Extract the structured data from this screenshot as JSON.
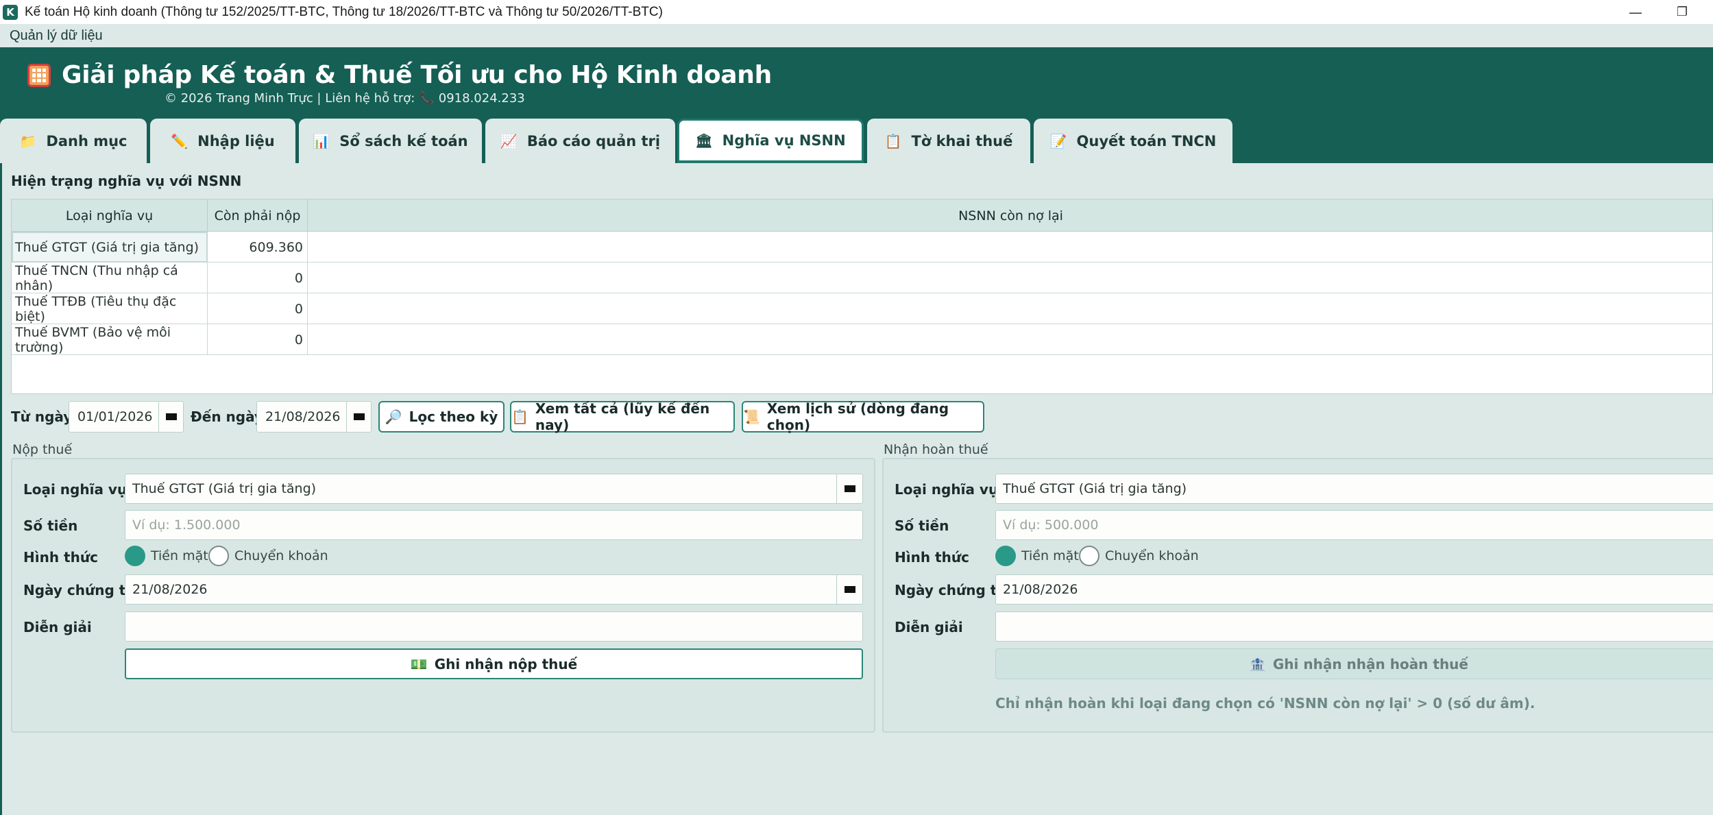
{
  "window": {
    "icon_letter": "K",
    "title": "Kế toán Hộ kinh doanh (Thông tư 152/2025/TT-BTC, Thông tư 18/2026/TT-BTC và Thông tư 50/2026/TT-BTC)",
    "minimize_glyph": "—",
    "restore_glyph": "❐"
  },
  "menu": {
    "data_management": "Quản lý dữ liệu"
  },
  "banner": {
    "title": "Giải pháp Kế toán & Thuế Tối ưu cho Hộ Kinh doanh",
    "subtitle": "© 2026 Trang Minh Trực | Liên hệ hỗ trợ:",
    "phone_icon": "📞",
    "phone": "0918.024.233"
  },
  "tabs": [
    {
      "icon": "📁",
      "label": "Danh mục"
    },
    {
      "icon": "✏️",
      "label": "Nhập liệu"
    },
    {
      "icon": "📊",
      "label": "Sổ sách kế toán"
    },
    {
      "icon": "📈",
      "label": "Báo cáo quản trị"
    },
    {
      "icon": "🏛",
      "label": "Nghĩa vụ NSNN",
      "active": true
    },
    {
      "icon": "📋",
      "label": "Tờ khai thuế"
    },
    {
      "icon": "📝",
      "label": "Quyết toán TNCN"
    }
  ],
  "status_section": {
    "title": "Hiện trạng nghĩa vụ với NSNN",
    "columns": [
      "Loại nghĩa vụ",
      "Còn phải nộp",
      "NSNN còn nợ lại"
    ],
    "rows": [
      {
        "type": "Thuế GTGT (Giá trị gia tăng)",
        "payable": "609.360",
        "owed_by_state": ""
      },
      {
        "type": "Thuế TNCN (Thu nhập cá nhân)",
        "payable": "0",
        "owed_by_state": ""
      },
      {
        "type": "Thuế TTĐB (Tiêu thụ đặc biệt)",
        "payable": "0",
        "owed_by_state": ""
      },
      {
        "type": "Thuế BVMT (Bảo vệ môi trường)",
        "payable": "0",
        "owed_by_state": ""
      }
    ]
  },
  "filter": {
    "from_label": "Từ ngày",
    "from_value": "01/01/2026",
    "to_label": "Đến ngày",
    "to_value": "21/08/2026",
    "filter_button": {
      "icon": "🔎",
      "label": "Lọc theo kỳ"
    },
    "view_all_button": {
      "icon": "📋",
      "label": "Xem tất cả (lũy kế đến nay)"
    },
    "history_button": {
      "icon": "📜",
      "label": "Xem lịch sử (dòng đang chọn)"
    }
  },
  "pay_group": {
    "title": "Nộp thuế",
    "type_label": "Loại nghĩa vụ",
    "type_value": "Thuế GTGT (Giá trị gia tăng)",
    "amount_label": "Số tiền",
    "amount_placeholder": "Ví dụ: 1.500.000",
    "method_label": "Hình thức",
    "method_cash": "Tiền mặt",
    "method_transfer": "Chuyển khoản",
    "date_label": "Ngày chứng từ",
    "date_value": "21/08/2026",
    "desc_label": "Diễn giải",
    "desc_value": "",
    "submit": {
      "icon": "💵",
      "label": "Ghi nhận nộp thuế"
    }
  },
  "refund_group": {
    "title": "Nhận hoàn thuế",
    "type_label": "Loại nghĩa vụ",
    "type_value": "Thuế GTGT (Giá trị gia tăng)",
    "amount_label": "Số tiền",
    "amount_placeholder": "Ví dụ: 500.000",
    "method_label": "Hình thức",
    "method_cash": "Tiền mặt",
    "method_transfer": "Chuyển khoản",
    "date_label": "Ngày chứng từ",
    "date_value": "21/08/2026",
    "desc_label": "Diễn giải",
    "desc_value": "",
    "submit": {
      "icon": "🏦",
      "label": "Ghi nhận nhận hoàn thuế"
    },
    "note": "Chỉ nhận hoàn khi loại đang chọn có 'NSNN còn nợ lại' > 0 (số dư âm)."
  },
  "colors": {
    "brand": "#155f55",
    "accent": "#2a9a88",
    "background": "#dde9e7"
  }
}
